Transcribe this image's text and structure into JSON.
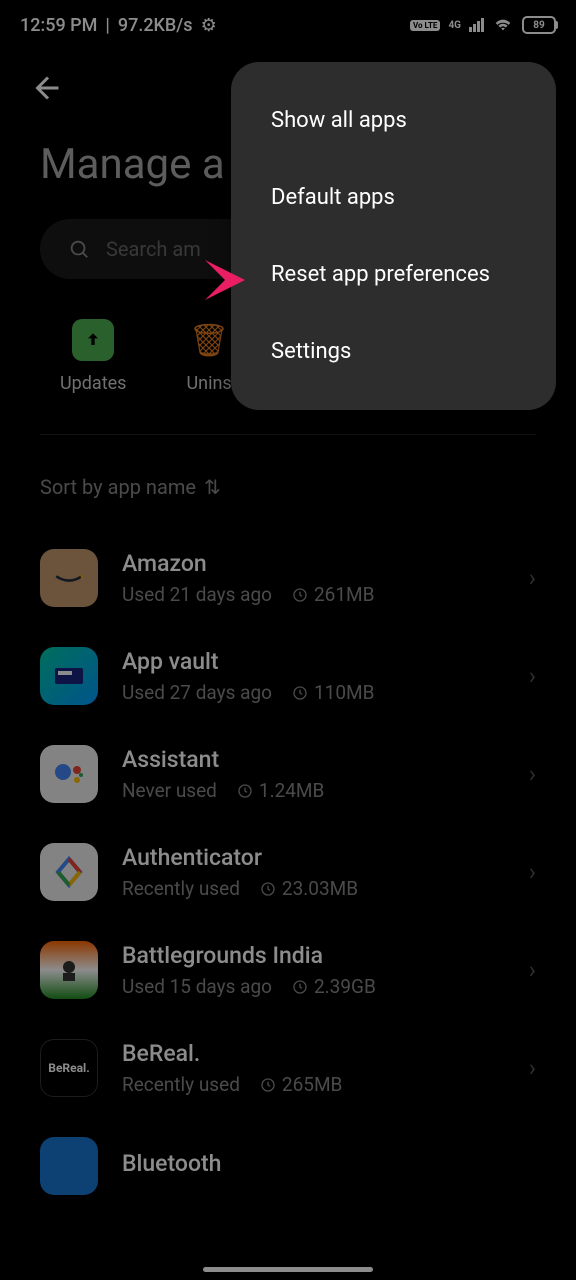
{
  "status_bar": {
    "time": "12:59 PM",
    "data_rate": "97.2KB/s",
    "volte": "Vo LTE",
    "network": "4G",
    "battery": "89"
  },
  "page": {
    "title": "Manage a",
    "search_placeholder": "Search am"
  },
  "actions": {
    "updates": "Updates",
    "uninstall": "Unins"
  },
  "sort": {
    "label": "Sort by app name"
  },
  "menu": {
    "show_all": "Show all apps",
    "default_apps": "Default apps",
    "reset": "Reset app preferences",
    "settings": "Settings"
  },
  "apps": [
    {
      "name": "Amazon",
      "usage": "Used 21 days ago",
      "size": "261MB"
    },
    {
      "name": "App vault",
      "usage": "Used 27 days ago",
      "size": "110MB"
    },
    {
      "name": "Assistant",
      "usage": "Never used",
      "size": "1.24MB"
    },
    {
      "name": "Authenticator",
      "usage": "Recently used",
      "size": "23.03MB"
    },
    {
      "name": "Battlegrounds India",
      "usage": "Used 15 days ago",
      "size": "2.39GB"
    },
    {
      "name": "BeReal.",
      "usage": "Recently used",
      "size": "265MB"
    },
    {
      "name": "Bluetooth",
      "usage": "",
      "size": ""
    }
  ]
}
